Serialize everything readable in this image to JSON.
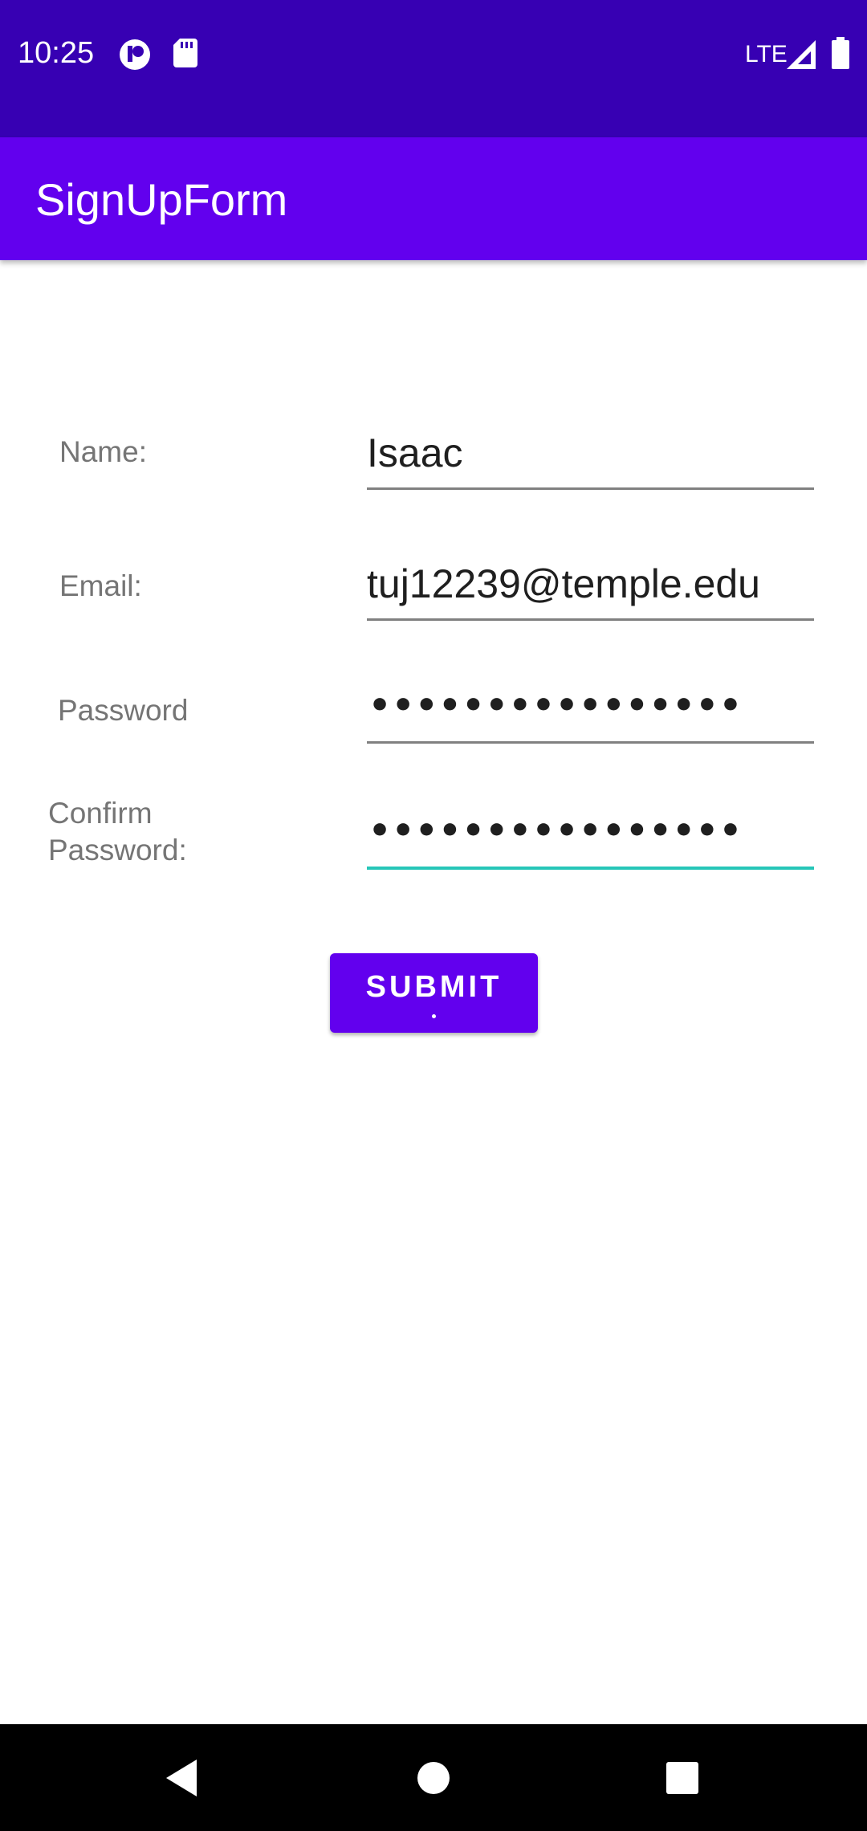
{
  "status_bar": {
    "time": "10:25",
    "network": "LTE",
    "icons": [
      "notification-app-icon",
      "sd-card-icon",
      "signal-icon",
      "battery-icon"
    ]
  },
  "app_bar": {
    "title": "SignUpForm"
  },
  "form": {
    "name_label": "Name:",
    "name_value": "Isaac",
    "email_label": "Email:",
    "email_value": "tuj12239@temple.edu",
    "password_label": "Password",
    "password_value": "••••••••••••••••",
    "confirm_label_line1": "Confirm",
    "confirm_label_line2": "Password:",
    "confirm_value": "••••••••••••••••",
    "submit_label": "SUBMIT"
  },
  "nav_bar": {
    "icons": [
      "back-icon",
      "home-icon",
      "recents-icon"
    ]
  },
  "colors": {
    "status_bar": "#3700b3",
    "app_bar": "#6200ee",
    "accent": "#26c6b8",
    "label": "#757575"
  }
}
